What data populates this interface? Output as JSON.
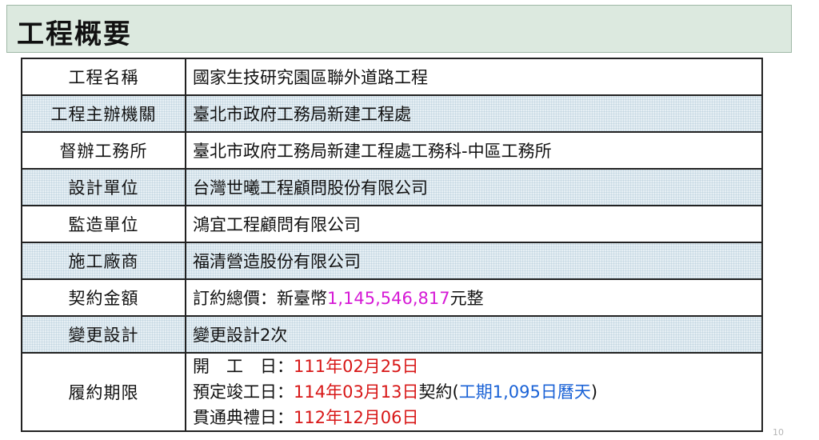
{
  "page_title": "工程概要",
  "page_number": "10",
  "rows": [
    {
      "label": "工程名稱",
      "value": "國家生技研究園區聯外道路工程"
    },
    {
      "label": "工程主辦機關",
      "value": "臺北市政府工務局新建工程處"
    },
    {
      "label": "督辦工務所",
      "value": "臺北市政府工務局新建工程處工務科-中區工務所"
    },
    {
      "label": "設計單位",
      "value": "台灣世曦工程顧問股份有限公司"
    },
    {
      "label": "監造單位",
      "value": "鴻宜工程顧問有限公司"
    },
    {
      "label": "施工廠商",
      "value": "福清營造股份有限公司"
    },
    {
      "label": "契約金額",
      "prefix": "訂約總價：新臺幣",
      "amount": "1,145,546,817",
      "suffix": "元整"
    },
    {
      "label": "變更設計",
      "value": "變更設計2次"
    }
  ],
  "schedule": {
    "label": "履約期限",
    "start_label": "開　工　日：",
    "start_date": "111年02月25日",
    "planned_label": "預定竣工日：",
    "planned_date": "114年03月13日",
    "contract_text": "契約(",
    "duration": "工期1,095日曆天",
    "close_paren": ")",
    "through_label": "貫通典禮日：",
    "through_date": "112年12月06日"
  },
  "colors": {
    "amount": "#d61ad6",
    "dates": "#d81818",
    "duration": "#1a62d6",
    "title_bar": "#dce9df"
  }
}
